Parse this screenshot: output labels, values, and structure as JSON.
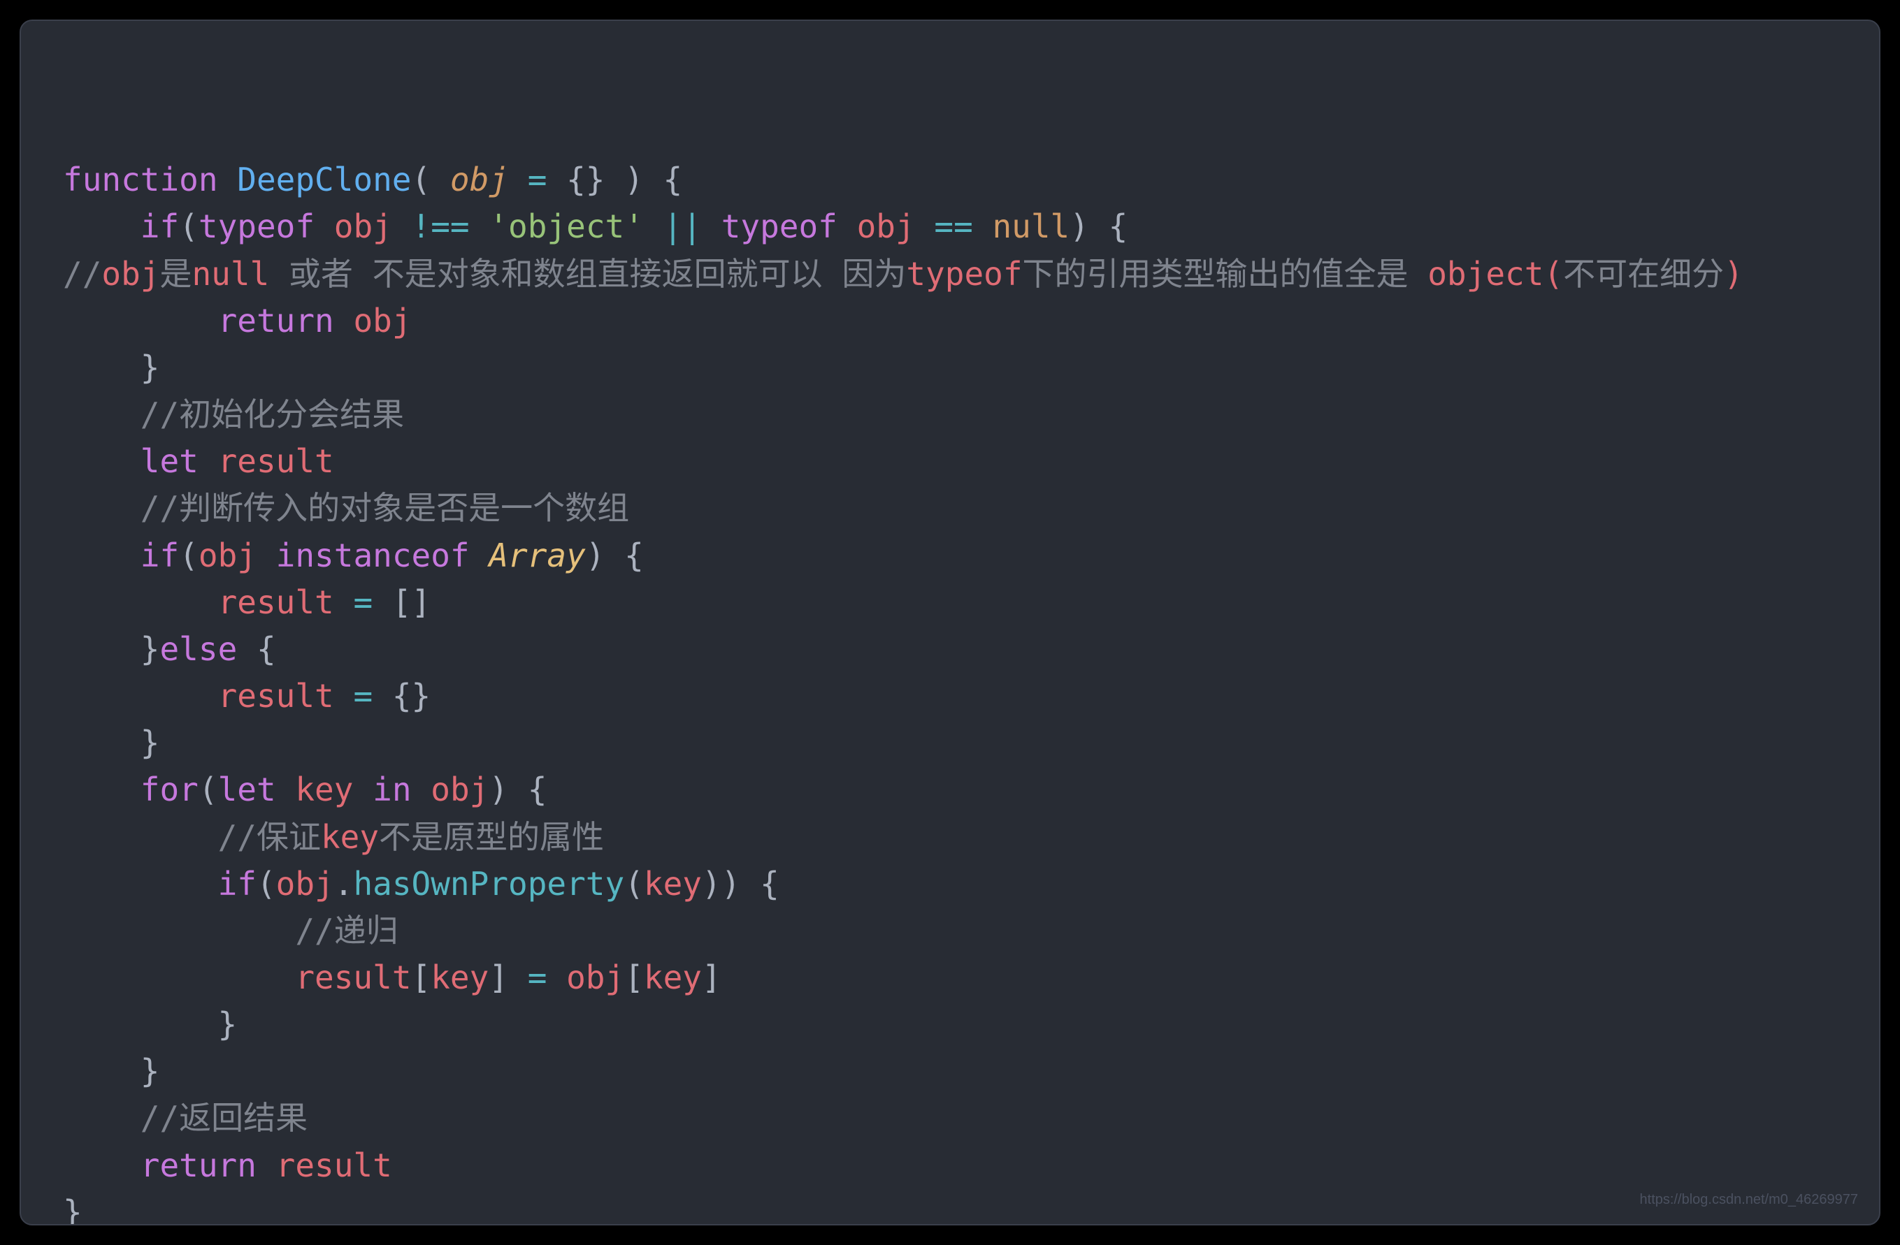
{
  "code": {
    "tokens": [
      [
        {
          "t": "function ",
          "c": "kw"
        },
        {
          "t": "DeepClone",
          "c": "fn"
        },
        {
          "t": "( ",
          "c": "pun"
        },
        {
          "t": "obj",
          "c": "pr"
        },
        {
          "t": " ",
          "c": "pun"
        },
        {
          "t": "=",
          "c": "op"
        },
        {
          "t": " {} ) {",
          "c": "pun"
        }
      ],
      [
        {
          "t": "    ",
          "c": "pun"
        },
        {
          "t": "if",
          "c": "kw"
        },
        {
          "t": "(",
          "c": "pun"
        },
        {
          "t": "typeof ",
          "c": "kw"
        },
        {
          "t": "obj",
          "c": "id"
        },
        {
          "t": " ",
          "c": "pun"
        },
        {
          "t": "!==",
          "c": "op"
        },
        {
          "t": " ",
          "c": "pun"
        },
        {
          "t": "'object'",
          "c": "str"
        },
        {
          "t": " ",
          "c": "pun"
        },
        {
          "t": "||",
          "c": "op"
        },
        {
          "t": " ",
          "c": "pun"
        },
        {
          "t": "typeof ",
          "c": "kw"
        },
        {
          "t": "obj",
          "c": "id"
        },
        {
          "t": " ",
          "c": "pun"
        },
        {
          "t": "==",
          "c": "op"
        },
        {
          "t": " ",
          "c": "pun"
        },
        {
          "t": "null",
          "c": "null"
        },
        {
          "t": ") {",
          "c": "pun"
        }
      ],
      [
        {
          "t": "",
          "c": "pun"
        }
      ],
      [
        {
          "t": "//",
          "c": "cmt"
        },
        {
          "t": "obj",
          "c": "id"
        },
        {
          "t": "是",
          "c": "cmt"
        },
        {
          "t": "null",
          "c": "id"
        },
        {
          "t": " 或者 不是对象和数组直接返回就可以 因为",
          "c": "cmt"
        },
        {
          "t": "typeof",
          "c": "id"
        },
        {
          "t": "下的引用类型输出的值全是 ",
          "c": "cmt"
        },
        {
          "t": "object(",
          "c": "id"
        },
        {
          "t": "不可在细分",
          "c": "cmt"
        },
        {
          "t": ")",
          "c": "id"
        }
      ],
      [
        {
          "t": "        ",
          "c": "pun"
        },
        {
          "t": "return ",
          "c": "kw"
        },
        {
          "t": "obj",
          "c": "id"
        }
      ],
      [
        {
          "t": "    }",
          "c": "pun"
        }
      ],
      [
        {
          "t": "    ",
          "c": "pun"
        },
        {
          "t": "//初始化分会结果",
          "c": "cmt"
        }
      ],
      [
        {
          "t": "    ",
          "c": "pun"
        },
        {
          "t": "let ",
          "c": "kw"
        },
        {
          "t": "result",
          "c": "id"
        }
      ],
      [
        {
          "t": "    ",
          "c": "pun"
        },
        {
          "t": "//判断传入的对象是否是一个数组",
          "c": "cmt"
        }
      ],
      [
        {
          "t": "    ",
          "c": "pun"
        },
        {
          "t": "if",
          "c": "kw"
        },
        {
          "t": "(",
          "c": "pun"
        },
        {
          "t": "obj",
          "c": "id"
        },
        {
          "t": " ",
          "c": "pun"
        },
        {
          "t": "instanceof ",
          "c": "kw"
        },
        {
          "t": "Array",
          "c": "cls"
        },
        {
          "t": ") {",
          "c": "pun"
        }
      ],
      [
        {
          "t": "        ",
          "c": "pun"
        },
        {
          "t": "result",
          "c": "id"
        },
        {
          "t": " ",
          "c": "pun"
        },
        {
          "t": "=",
          "c": "op"
        },
        {
          "t": " []",
          "c": "pun"
        }
      ],
      [
        {
          "t": "    }",
          "c": "pun"
        },
        {
          "t": "else ",
          "c": "kw"
        },
        {
          "t": "{",
          "c": "pun"
        }
      ],
      [
        {
          "t": "        ",
          "c": "pun"
        },
        {
          "t": "result",
          "c": "id"
        },
        {
          "t": " ",
          "c": "pun"
        },
        {
          "t": "=",
          "c": "op"
        },
        {
          "t": " {}",
          "c": "pun"
        }
      ],
      [
        {
          "t": "    }",
          "c": "pun"
        }
      ],
      [
        {
          "t": "    ",
          "c": "pun"
        },
        {
          "t": "for",
          "c": "kw"
        },
        {
          "t": "(",
          "c": "pun"
        },
        {
          "t": "let ",
          "c": "kw"
        },
        {
          "t": "key",
          "c": "id"
        },
        {
          "t": " ",
          "c": "pun"
        },
        {
          "t": "in ",
          "c": "kw"
        },
        {
          "t": "obj",
          "c": "id"
        },
        {
          "t": ") {",
          "c": "pun"
        }
      ],
      [
        {
          "t": "        ",
          "c": "pun"
        },
        {
          "t": "//保证",
          "c": "cmt"
        },
        {
          "t": "key",
          "c": "id"
        },
        {
          "t": "不是原型的属性",
          "c": "cmt"
        }
      ],
      [
        {
          "t": "        ",
          "c": "pun"
        },
        {
          "t": "if",
          "c": "kw"
        },
        {
          "t": "(",
          "c": "pun"
        },
        {
          "t": "obj",
          "c": "id"
        },
        {
          "t": ".",
          "c": "pun"
        },
        {
          "t": "hasOwnProperty",
          "c": "mth"
        },
        {
          "t": "(",
          "c": "pun"
        },
        {
          "t": "key",
          "c": "id"
        },
        {
          "t": ")) {",
          "c": "pun"
        }
      ],
      [
        {
          "t": "            ",
          "c": "pun"
        },
        {
          "t": "//递归",
          "c": "cmt"
        }
      ],
      [
        {
          "t": "            ",
          "c": "pun"
        },
        {
          "t": "result",
          "c": "id"
        },
        {
          "t": "[",
          "c": "pun"
        },
        {
          "t": "key",
          "c": "id"
        },
        {
          "t": "] ",
          "c": "pun"
        },
        {
          "t": "=",
          "c": "op"
        },
        {
          "t": " ",
          "c": "pun"
        },
        {
          "t": "obj",
          "c": "id"
        },
        {
          "t": "[",
          "c": "pun"
        },
        {
          "t": "key",
          "c": "id"
        },
        {
          "t": "]",
          "c": "pun"
        }
      ],
      [
        {
          "t": "        }",
          "c": "pun"
        }
      ],
      [
        {
          "t": "    }",
          "c": "pun"
        }
      ],
      [
        {
          "t": "    ",
          "c": "pun"
        },
        {
          "t": "//返回结果",
          "c": "cmt"
        }
      ],
      [
        {
          "t": "    ",
          "c": "pun"
        },
        {
          "t": "return ",
          "c": "kw"
        },
        {
          "t": "result",
          "c": "id"
        }
      ],
      [
        {
          "t": "}",
          "c": "pun"
        }
      ]
    ]
  },
  "watermark": "https://blog.csdn.net/m0_46269977"
}
